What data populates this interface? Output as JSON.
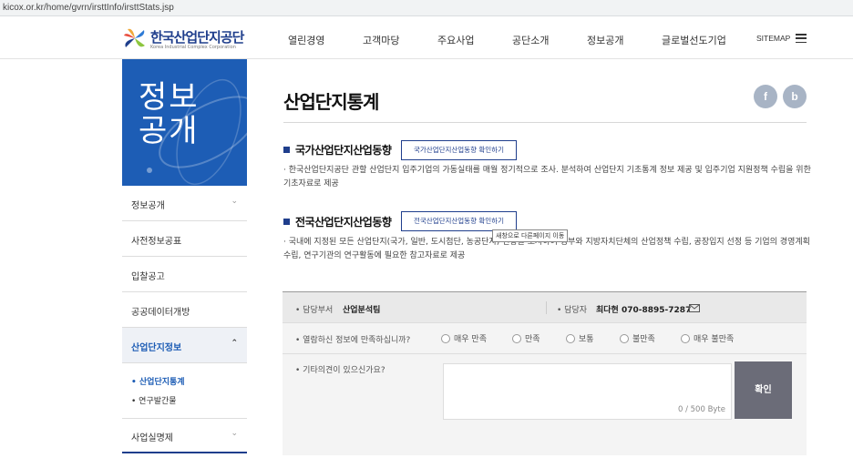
{
  "browser": {
    "url": "kicox.or.kr/home/gvrn/irsttInfo/irsttStats.jsp"
  },
  "header": {
    "logo_title": "한국산업단지공단",
    "logo_sub": "Korea Industrial Complex Corporation",
    "nav": [
      "열린경영",
      "고객마당",
      "주요사업",
      "공단소개",
      "정보공개",
      "글로벌선도기업"
    ],
    "sitemap": "SITEMAP"
  },
  "sidebar": {
    "hero_title": "정보공개",
    "items": [
      {
        "label": "정보공개",
        "chevron": "⌄"
      },
      {
        "label": "사전정보공표"
      },
      {
        "label": "입찰공고"
      },
      {
        "label": "공공데이터개방"
      },
      {
        "label": "산업단지정보",
        "chevron": "⌃"
      }
    ],
    "subitems": [
      "• 산업단지통계",
      "• 연구발간물"
    ],
    "last_item": {
      "label": "사업실명제",
      "chevron": "⌄"
    }
  },
  "main": {
    "title": "산업단지통계",
    "share": {
      "facebook": "f",
      "blog": "b"
    },
    "sections": [
      {
        "heading": "국가산업단지산업동향",
        "button": "국가산업단지산업동향 확인하기",
        "desc": "· 한국산업단지공단 관할 산업단지 입주기업의 가동실태를 매월 정기적으로 조사. 분석하여 산업단지 기초통계 정보 제공 및 입주기업 지원정책 수립을 위한 기초자료로 제공"
      },
      {
        "heading": "전국산업단지산업동향",
        "button": "전국산업단지산업동향 확인하기",
        "desc": "· 국내에 지정된 모든 산업단지(국가, 일반, 도시첨단, 농공단지) 현황을 조사하여 정부와 지방자치단체의 산업정책 수립, 공장입지 선정 등 기업의 경영계획 수립, 연구기관의 연구활동에 필요한 참고자료로 제공"
      }
    ],
    "tooltip": "새창으로 다른페이지 이동"
  },
  "survey": {
    "dept_label": "• 담당부서",
    "dept_value": "산업분석팀",
    "manager_label": "• 담당자",
    "manager_value": "최다현 070-8895-7287",
    "question": "• 열람하신 정보에 만족하십니까?",
    "options": [
      "매우 만족",
      "만족",
      "보통",
      "불만족",
      "매우 불만족"
    ],
    "comment_label": "• 기타의견이 있으신가요?",
    "counter": "0 / 500 Byte",
    "confirm": "확인"
  }
}
